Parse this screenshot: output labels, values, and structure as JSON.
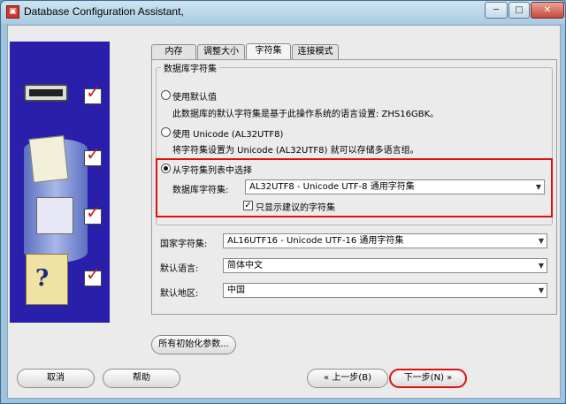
{
  "window": {
    "title": "Database Configuration Assistant,",
    "app_icon_glyph": "▣"
  },
  "tabs": [
    {
      "label": "内存",
      "active": false
    },
    {
      "label": "调整大小",
      "active": false
    },
    {
      "label": "字符集",
      "active": true
    },
    {
      "label": "连接模式",
      "active": false
    }
  ],
  "db_charset": {
    "group_title": "数据库字符集",
    "option_default_label": "使用默认值",
    "option_default_desc": "此数据库的默认字符集是基于此操作系统的语言设置: ZHS16GBK。",
    "option_unicode_label": "使用 Unicode (AL32UTF8)",
    "option_unicode_desc": "将字符集设置为 Unicode (AL32UTF8) 就可以存储多语言组。",
    "option_list_label": "从字符集列表中选择",
    "charset_field_label": "数据库字符集:",
    "charset_value": "AL32UTF8 - Unicode UTF-8 通用字符集",
    "recommended_only_label": "只显示建议的字符集",
    "recommended_only_checked": true
  },
  "national_charset": {
    "label": "国家字符集:",
    "value": "AL16UTF16 - Unicode UTF-16 通用字符集"
  },
  "default_language": {
    "label": "默认语言:",
    "value": "简体中文"
  },
  "default_territory": {
    "label": "默认地区:",
    "value": "中国"
  },
  "buttons": {
    "all_params": "所有初始化参数...",
    "cancel": "取消",
    "help": "帮助",
    "back": "上一步(B)",
    "next": "下一步(N)"
  },
  "icons": {
    "dropdown_arrow": "▼",
    "back_arrow": "«",
    "next_arrow": "»",
    "check": "✓",
    "min": "─",
    "max": "□",
    "close": "✕",
    "help_glyph": "?"
  },
  "colors": {
    "highlight_border": "#e01010",
    "illustration_bg": "#2a1faa"
  }
}
